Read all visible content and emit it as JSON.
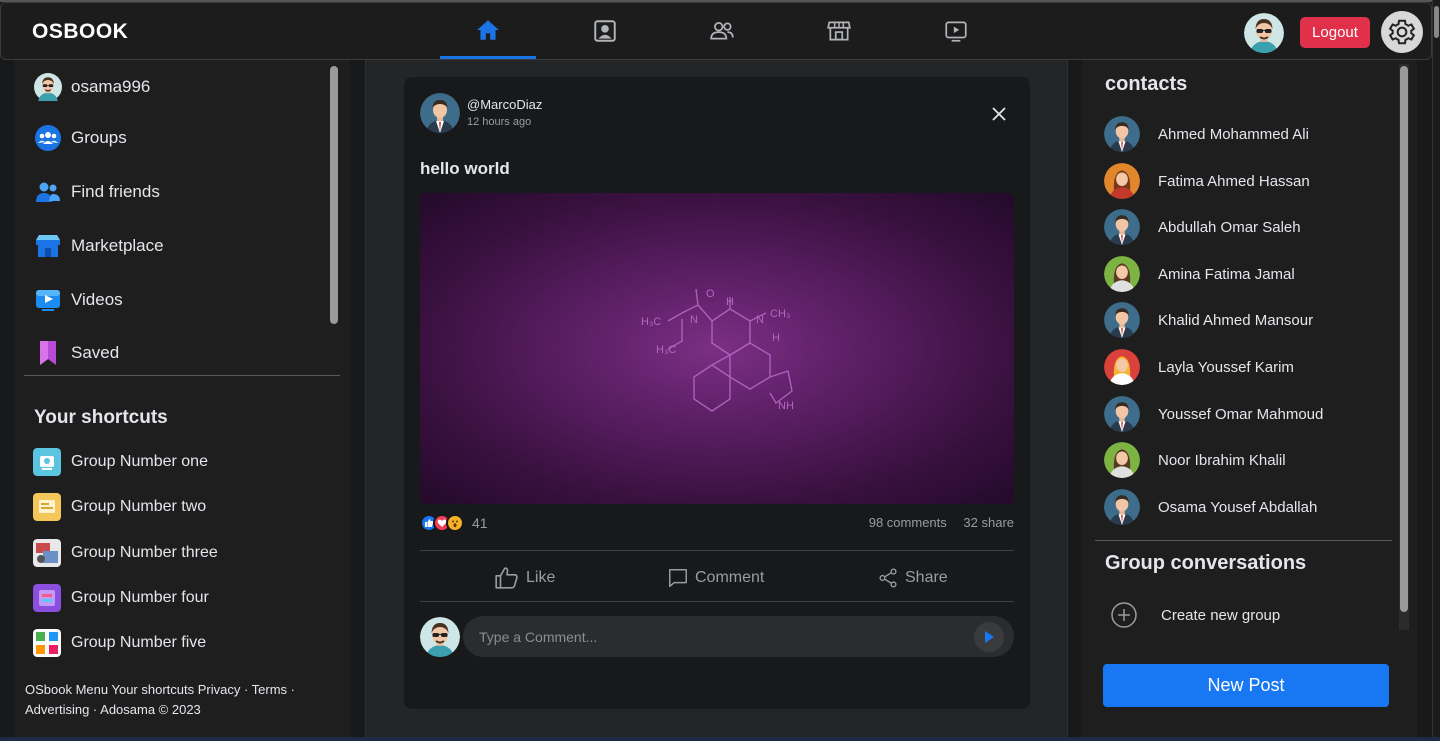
{
  "app": {
    "title": "OSBOOK"
  },
  "navbar": {
    "tabs": [
      {
        "name": "home",
        "icon": "home-icon",
        "active": true
      },
      {
        "name": "profile",
        "icon": "profile-icon",
        "active": false
      },
      {
        "name": "friends",
        "icon": "friends-icon",
        "active": false
      },
      {
        "name": "marketplace",
        "icon": "store-icon",
        "active": false
      },
      {
        "name": "watch",
        "icon": "video-icon",
        "active": false
      }
    ],
    "logout_label": "Logout",
    "accent_color": "#1b74e4",
    "logout_color": "#e0304a"
  },
  "left_menu": {
    "items": [
      {
        "label": "osama996",
        "icon": "user-avatar-icon"
      },
      {
        "label": "Groups",
        "icon": "groups-icon"
      },
      {
        "label": "Find friends",
        "icon": "find-friends-icon"
      },
      {
        "label": "Marketplace",
        "icon": "marketplace-icon"
      },
      {
        "label": "Videos",
        "icon": "videos-icon"
      },
      {
        "label": "Saved",
        "icon": "saved-icon"
      }
    ]
  },
  "shortcuts": {
    "title": "Your shortcuts",
    "items": [
      {
        "label": "Group Number one"
      },
      {
        "label": "Group Number two"
      },
      {
        "label": "Group Number three"
      },
      {
        "label": "Group Number four"
      },
      {
        "label": "Group Number five"
      }
    ]
  },
  "footer": {
    "line1": "OSbook Menu Your shortcuts Privacy · Terms ·",
    "line2": "Advertising · Adosama © 2023"
  },
  "post": {
    "author": "@MarcoDiaz",
    "time": "12 hours ago",
    "text": "hello world",
    "reactions_count": "41",
    "comments": "98 comments",
    "shares": "32 share",
    "actions": {
      "like": "Like",
      "comment": "Comment",
      "share": "Share"
    },
    "comment_placeholder": "Type a Comment..."
  },
  "contacts": {
    "title": "contacts",
    "items": [
      {
        "name": "Ahmed Mohammed Ali",
        "avatar": "man"
      },
      {
        "name": "Fatima Ahmed Hassan",
        "avatar": "woman-orange"
      },
      {
        "name": "Abdullah Omar Saleh",
        "avatar": "man"
      },
      {
        "name": "Amina Fatima Jamal",
        "avatar": "woman-green"
      },
      {
        "name": "Khalid Ahmed Mansour",
        "avatar": "man"
      },
      {
        "name": "Layla Youssef Karim",
        "avatar": "woman-red"
      },
      {
        "name": "Youssef Omar Mahmoud",
        "avatar": "man"
      },
      {
        "name": "Noor Ibrahim Khalil",
        "avatar": "woman-green"
      },
      {
        "name": "Osama Yousef Abdallah",
        "avatar": "man"
      }
    ]
  },
  "group_conversations": {
    "title": "Group conversations",
    "create_label": "Create new group"
  },
  "new_post_label": "New Post"
}
